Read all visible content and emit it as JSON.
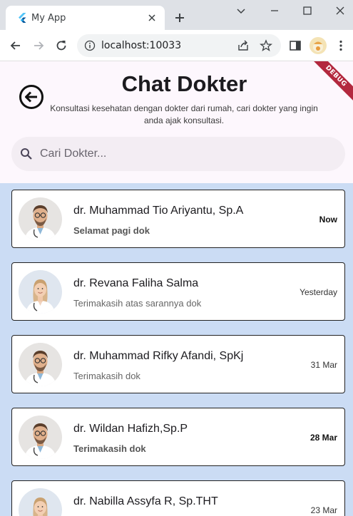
{
  "browser": {
    "tab_title": "My App",
    "url": "localhost:10033"
  },
  "app": {
    "debug_label": "DEBUG",
    "title": "Chat Dokter",
    "subtitle": "Konsultasi kesehatan dengan dokter dari rumah, cari dokter yang ingin anda ajak konsultasi.",
    "search": {
      "placeholder": "Cari Dokter..."
    },
    "chats": [
      {
        "name": "dr. Muhammad Tio Ariyantu, Sp.A",
        "message": "Selamat pagi dok",
        "time": "Now",
        "unread": true,
        "avatar": "male-doctor"
      },
      {
        "name": "dr. Revana Faliha Salma",
        "message": "Terimakasih atas sarannya dok",
        "time": "Yesterday",
        "unread": false,
        "avatar": "female-doctor"
      },
      {
        "name": "dr. Muhammad Rifky Afandi, SpKj",
        "message": "Terimakasih dok",
        "time": "31 Mar",
        "unread": false,
        "avatar": "male-doctor"
      },
      {
        "name": "dr. Wildan Hafizh,Sp.P",
        "message": "Terimakasih dok",
        "time": "28 Mar",
        "unread": true,
        "avatar": "male-doctor"
      },
      {
        "name": "dr. Nabilla Assyfa R, Sp.THT",
        "message": "",
        "time": "23 Mar",
        "unread": false,
        "avatar": "female-doctor"
      }
    ]
  },
  "colors": {
    "header_bg": "#fdf7fd",
    "list_bg": "#cbdcf4",
    "search_bg": "#f3edf3",
    "debug_banner": "#b3283e"
  }
}
